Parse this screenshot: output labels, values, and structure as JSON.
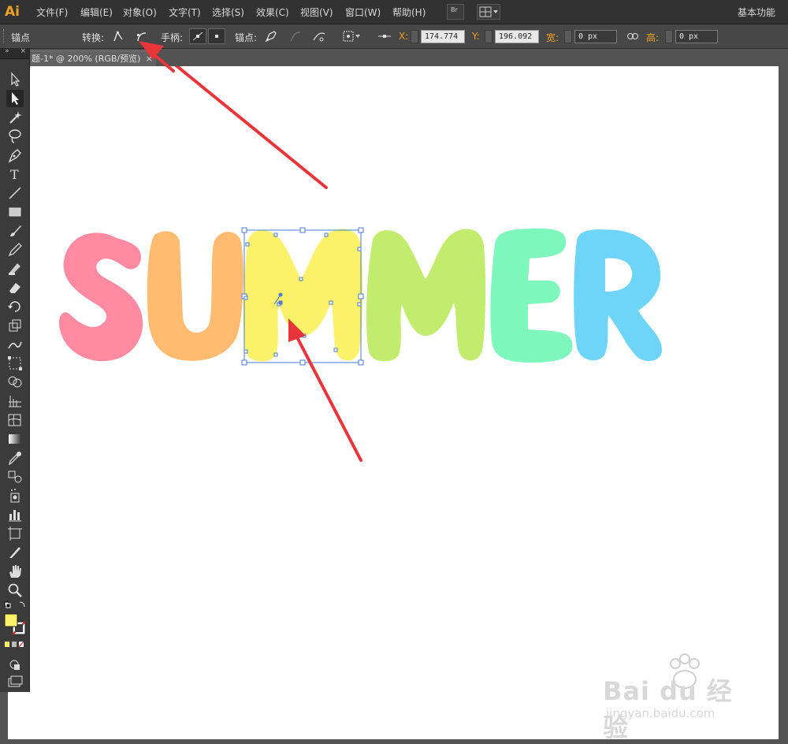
{
  "menubar": {
    "app_logo": "Ai",
    "items": [
      "文件(F)",
      "编辑(E)",
      "对象(O)",
      "文字(T)",
      "选择(S)",
      "效果(C)",
      "视图(V)",
      "窗口(W)",
      "帮助(H)"
    ],
    "bridge_label": "Br",
    "workspace": "基本功能"
  },
  "controlbar": {
    "anchor_label": "锚点",
    "convert_label": "转换:",
    "handles_label": "手柄:",
    "anchors_label": "锚点:",
    "x_label": "X:",
    "x_value": "174.774",
    "y_label": "Y:",
    "y_value": "196.092",
    "w_label": "宽:",
    "w_value": "0 px",
    "h_label": "高:",
    "h_value": "0 px"
  },
  "document": {
    "tab_title": "题-1* @ 200% (RGB/预览)",
    "close": "×"
  },
  "artwork": {
    "letters": [
      "S",
      "U",
      "M",
      "M",
      "E",
      "R"
    ],
    "colors": {
      "S": "#ff8aa2",
      "U": "#ffbb70",
      "M1": "#fbf26a",
      "M2": "#c2ec6e",
      "E": "#7ef7bd",
      "R": "#6ed4f8"
    },
    "annotation_color": "#e8353a"
  },
  "watermark": {
    "brand": "Bai du 经验",
    "url": "jingyan.baidu.com"
  },
  "icons": {
    "selection": "selection-tool-icon",
    "direct_selection": "direct-selection-tool-icon",
    "pen": "pen-tool-icon",
    "type": "type-tool-icon",
    "hand": "hand-tool-icon",
    "zoom": "zoom-tool-icon"
  }
}
